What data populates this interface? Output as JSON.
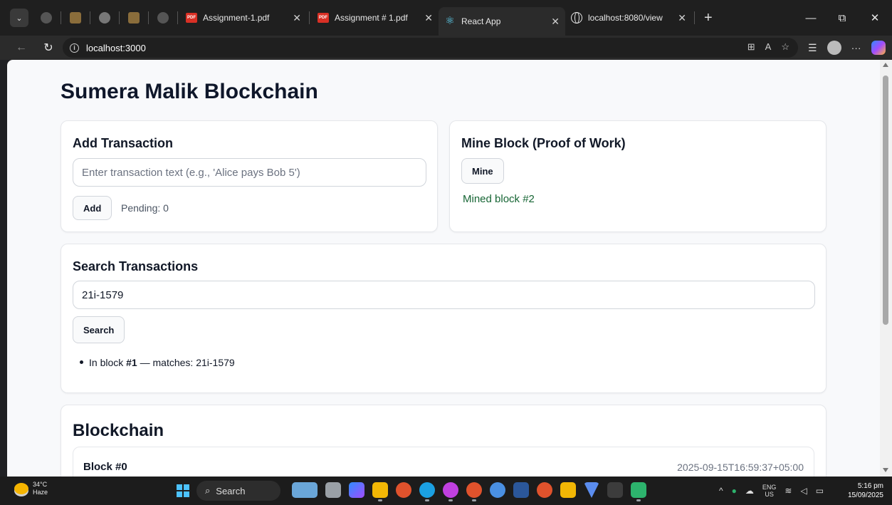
{
  "browser": {
    "tabs": [
      {
        "title": "Assignment-1.pdf",
        "icon": "pdf-icon"
      },
      {
        "title": "Assignment # 1.pdf",
        "icon": "pdf-icon"
      },
      {
        "title": "React App",
        "icon": "react-icon",
        "active": true
      },
      {
        "title": "localhost:8080/view",
        "icon": "globe-icon"
      }
    ],
    "address": "localhost:3000"
  },
  "page": {
    "title": "Sumera Malik Blockchain",
    "add_transaction": {
      "heading": "Add Transaction",
      "placeholder": "Enter transaction text (e.g., 'Alice pays Bob 5')",
      "button_label": "Add",
      "pending_text": "Pending: 0"
    },
    "mine_block": {
      "heading": "Mine Block (Proof of Work)",
      "button_label": "Mine",
      "status": "Mined block #2",
      "status_color": "#166534"
    },
    "search": {
      "heading": "Search Transactions",
      "query": "21i-1579",
      "button_label": "Search",
      "result_prefix": "In block ",
      "result_block": "#1",
      "result_suffix": " — matches: 21i-1579"
    },
    "blockchain": {
      "heading": "Blockchain",
      "blocks": [
        {
          "title": "Block #0",
          "timestamp": "2025-09-15T16:59:37+05:00"
        }
      ]
    }
  },
  "taskbar": {
    "weather_temp": "34°C",
    "weather_desc": "Haze",
    "search_label": "Search",
    "lang_top": "ENG",
    "lang_bottom": "US",
    "time": "5:16 pm",
    "date": "15/09/2025"
  }
}
